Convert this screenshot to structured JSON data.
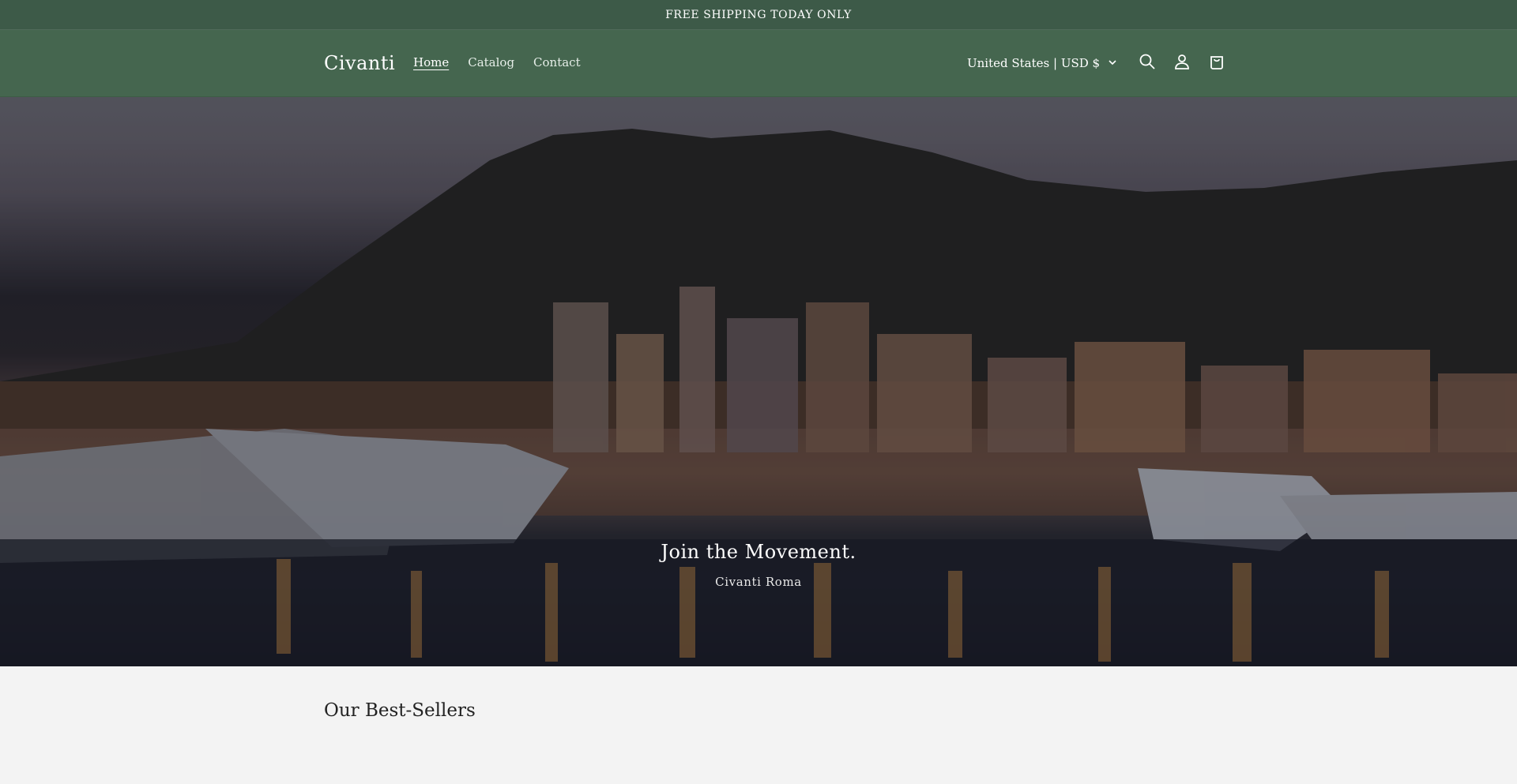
{
  "announcement": {
    "text": "FREE SHIPPING TODAY ONLY"
  },
  "header": {
    "logo": "Civanti",
    "nav": [
      {
        "label": "Home",
        "active": true
      },
      {
        "label": "Catalog",
        "active": false
      },
      {
        "label": "Contact",
        "active": false
      }
    ],
    "locale_label": "United States | USD $",
    "icons": {
      "locale_chevron": "chevron-down-icon",
      "search": "search-icon",
      "account": "account-icon",
      "cart": "cart-icon"
    }
  },
  "hero": {
    "title": "Join the Movement.",
    "subtitle": "Civanti Roma"
  },
  "bestsellers": {
    "heading": "Our Best-Sellers"
  },
  "colors": {
    "header_bg": "#45664f",
    "announcement_bg": "#3d5a48",
    "page_bg": "#f3f3f3"
  }
}
